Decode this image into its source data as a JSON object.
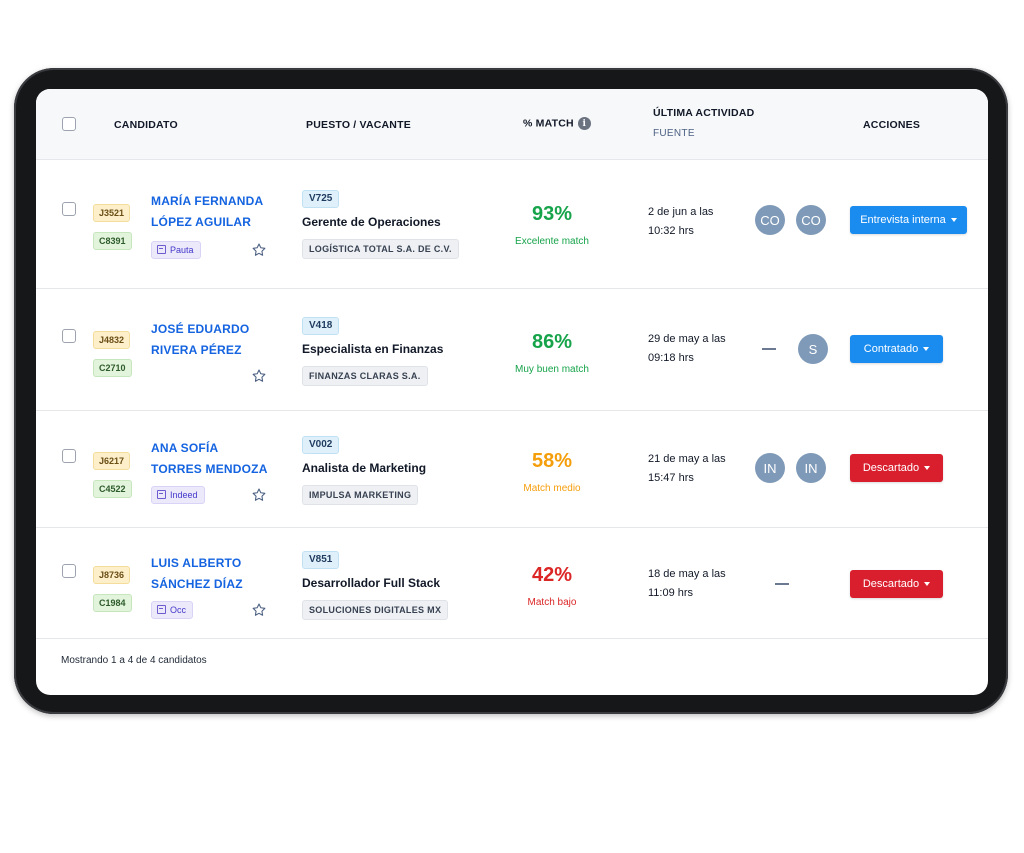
{
  "header": {
    "candidato": "CANDIDATO",
    "puesto": "PUESTO / VACANTE",
    "match": "% MATCH",
    "match_info_icon": "info-icon",
    "ultima_actividad": "ÚLTIMA ACTIVIDAD",
    "fuente": "FUENTE",
    "acciones": "ACCIONES"
  },
  "colors": {
    "link_blue": "#1463e0",
    "green": "#16a34a",
    "orange": "#f59e0b",
    "red": "#dc2626",
    "btn_blue": "#1a8cf0",
    "btn_red": "#d91f2e"
  },
  "rows": [
    {
      "job_code": "J3521",
      "cand_code": "C8391",
      "name_line1": "MARÍA FERNANDA",
      "name_line2": "LÓPEZ AGUILAR",
      "source": "Pauta",
      "vacancy_code": "V725",
      "vacancy_title": "Gerente de Operaciones",
      "company": "LOGÍSTICA TOTAL S.A. DE C.V.",
      "match_pct": "93%",
      "match_label": "Excelente match",
      "activity_line1": "2 de jun a las",
      "activity_line2": "10:32 hrs",
      "avatar1": "CO",
      "avatar2": "CO",
      "action": "Entrevista interna"
    },
    {
      "job_code": "J4832",
      "cand_code": "C2710",
      "name_line1": "JOSÉ EDUARDO",
      "name_line2": "RIVERA PÉREZ",
      "vacancy_code": "V418",
      "vacancy_title": "Especialista en Finanzas",
      "company": "FINANZAS CLARAS S.A.",
      "match_pct": "86%",
      "match_label": "Muy buen match",
      "activity_line1": "29 de may a las",
      "activity_line2": "09:18 hrs",
      "avatar2": "S",
      "action": "Contratado"
    },
    {
      "job_code": "J6217",
      "cand_code": "C4522",
      "name_line1": "ANA SOFÍA",
      "name_line2": "TORRES MENDOZA",
      "source": "Indeed",
      "vacancy_code": "V002",
      "vacancy_title": "Analista de Marketing",
      "company": "IMPULSA MARKETING",
      "match_pct": "58%",
      "match_label": "Match medio",
      "activity_line1": "21 de may a las",
      "activity_line2": "15:47 hrs",
      "avatar1": "IN",
      "avatar2": "IN",
      "action": "Descartado"
    },
    {
      "job_code": "J8736",
      "cand_code": "C1984",
      "name_line1": "LUIS ALBERTO",
      "name_line2": "SÁNCHEZ DÍAZ",
      "source": "Occ",
      "vacancy_code": "V851",
      "vacancy_title": "Desarrollador Full Stack",
      "company": "SOLUCIONES DIGITALES MX",
      "match_pct": "42%",
      "match_label": "Match bajo",
      "activity_line1": "18 de may a las",
      "activity_line2": "11:09 hrs",
      "action": "Descartado"
    }
  ],
  "footer": {
    "summary": "Mostrando 1 a 4 de 4 candidatos"
  }
}
